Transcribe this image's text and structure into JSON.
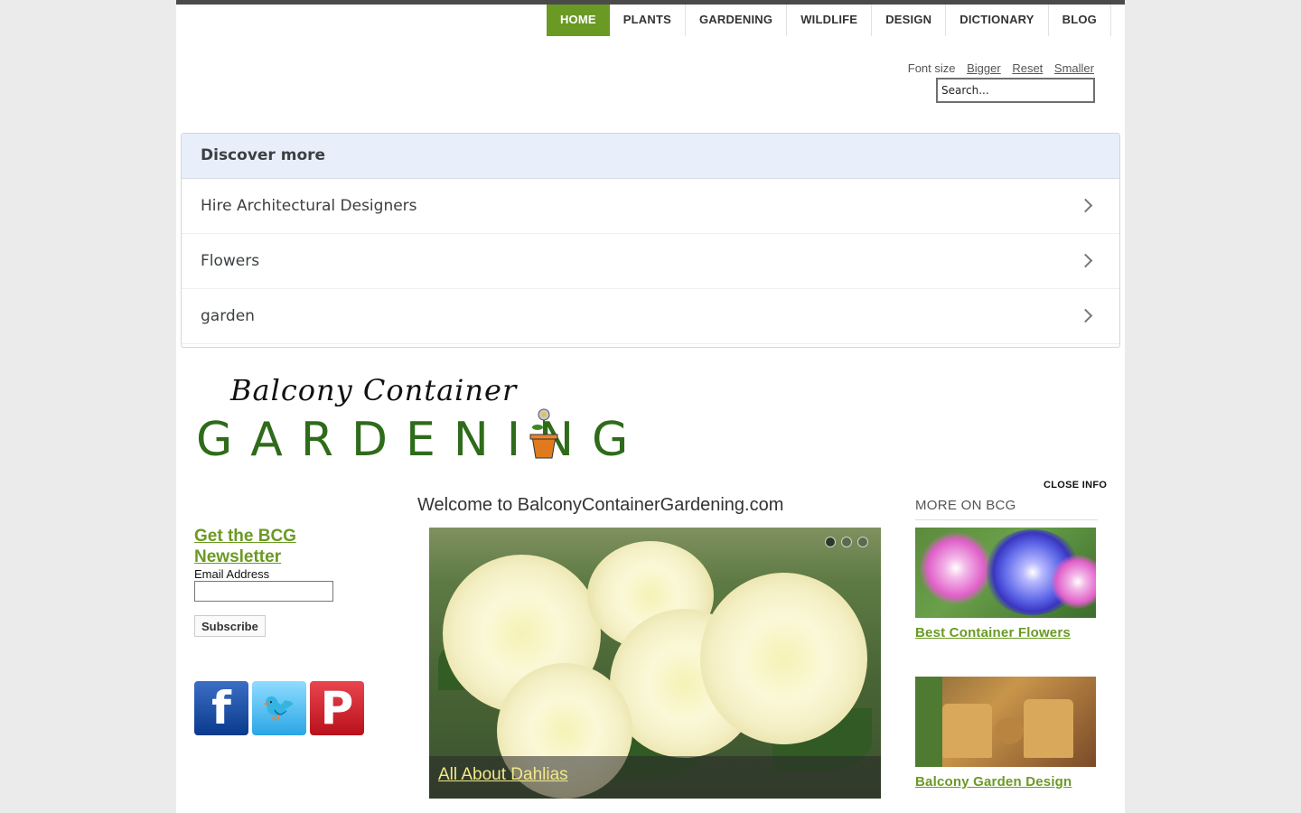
{
  "nav": {
    "items": [
      "HOME",
      "PLANTS",
      "GARDENING",
      "WILDLIFE",
      "DESIGN",
      "DICTIONARY",
      "BLOG"
    ],
    "active": "HOME"
  },
  "font_size": {
    "label": "Font size",
    "bigger": "Bigger",
    "reset": "Reset",
    "smaller": "Smaller"
  },
  "search": {
    "placeholder": "Search..."
  },
  "discover": {
    "title": "Discover more",
    "items": [
      "Hire Architectural Designers",
      "Flowers",
      "garden"
    ]
  },
  "logo": {
    "line1": "Balcony Container",
    "line2": "GARDENING"
  },
  "close_info": "CLOSE INFO",
  "newsletter": {
    "title": "Get the BCG Newsletter",
    "email_label": "Email Address",
    "subscribe": "Subscribe"
  },
  "social": [
    "facebook-icon",
    "twitter-icon",
    "pinterest-icon"
  ],
  "main": {
    "welcome": "Welcome to BalconyContainerGardening.com",
    "slide_caption": "All About Dahlias",
    "slide_count": 3,
    "active_slide": 1
  },
  "sidebar": {
    "title": "MORE ON BCG",
    "links": [
      "Best Container Flowers",
      "Balcony Garden Design"
    ]
  },
  "colors": {
    "accent": "#6a9a24",
    "discover_header": "#e8effb",
    "caption_link": "#f1e88a"
  }
}
